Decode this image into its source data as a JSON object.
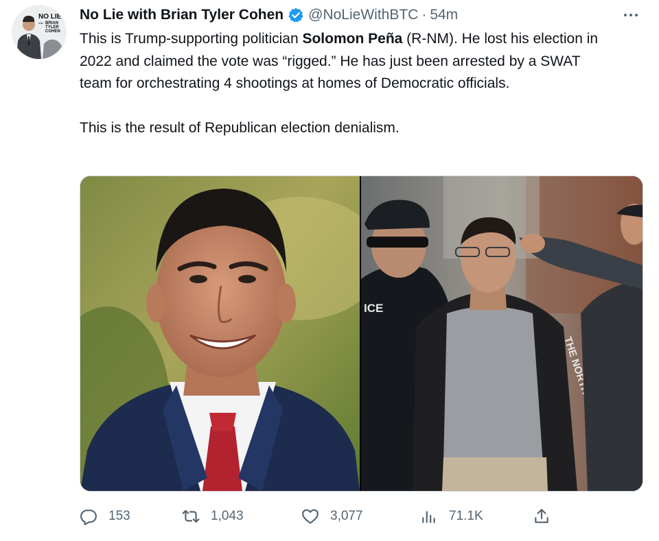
{
  "tweet": {
    "author_name": "No Lie with Brian Tyler Cohen",
    "handle": "@NoLieWithBTC",
    "separator": "·",
    "time": "54m",
    "avatar_logo_text": [
      "NO LIE",
      "with",
      "BRIAN",
      "TYLER",
      "COHEN"
    ],
    "body_line1_pre": "This is Trump-supporting politician ",
    "body_line1_bold": "Solomon Peña",
    "body_line1_post": " (R-NM). He lost his election in 2022 and claimed the vote was “rigged.” He has just been arrested by a SWAT team for orchestrating 4 shootings at homes of Democratic officials.",
    "body_line2": "This is the result of Republican election denialism.",
    "photo_right_text": [
      "ICE",
      "THE NORTH"
    ]
  },
  "actions": {
    "replies": "153",
    "retweets": "1,043",
    "likes": "3,077",
    "views": "71.1K"
  },
  "icons": {
    "verified": "verified-badge-icon",
    "more": "more-icon",
    "reply": "reply-icon",
    "retweet": "retweet-icon",
    "like": "heart-icon",
    "views": "views-chart-icon",
    "share": "share-icon"
  },
  "colors": {
    "text": "#0f1419",
    "secondary": "#536471",
    "verified": "#1d9bf0",
    "border": "#cfd9de"
  }
}
